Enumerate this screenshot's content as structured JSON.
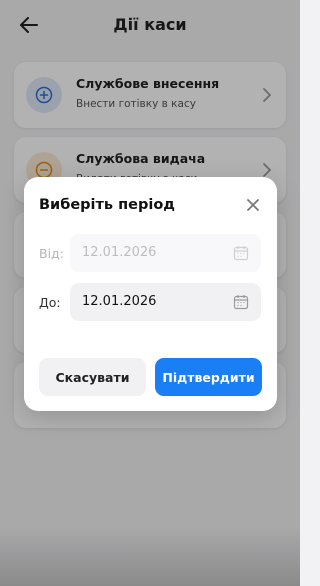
{
  "header": {
    "title": "Дії каси"
  },
  "cards": [
    {
      "title": "Службове внесення",
      "subtitle": "Внести готівку в касу",
      "icon": "plus-circle-icon",
      "icon_color": "#2b6fd6",
      "icon_bg": "#dfe9fa"
    },
    {
      "title": "Службова видача",
      "subtitle": "Видати готівку з каси",
      "icon": "minus-circle-icon",
      "icon_color": "#e08a1e",
      "icon_bg": "#fbead3"
    }
  ],
  "modal": {
    "title": "Виберіть період",
    "from_label": "Від:",
    "from_value": "12.01.2026",
    "to_label": "До:",
    "to_value": "12.01.2026",
    "cancel_label": "Скасувати",
    "confirm_label": "Підтвердити",
    "accent": "#1a7ff4"
  }
}
